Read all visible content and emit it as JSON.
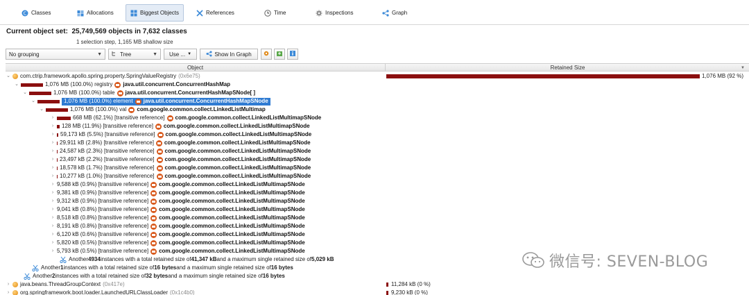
{
  "tabs": [
    {
      "label": "Classes",
      "icon": "classes-icon",
      "active": false
    },
    {
      "label": "Allocations",
      "icon": "allocations-icon",
      "active": false
    },
    {
      "label": "Biggest Objects",
      "icon": "biggest-objects-icon",
      "active": true
    },
    {
      "label": "References",
      "icon": "references-icon",
      "active": false
    },
    {
      "label": "Time",
      "icon": "clock-icon",
      "active": false
    },
    {
      "label": "Inspections",
      "icon": "gear-icon",
      "active": false
    },
    {
      "label": "Graph",
      "icon": "graph-icon",
      "active": false
    }
  ],
  "header": {
    "title_prefix": "Current object set:",
    "title_value": "25,749,569 objects in 7,632 classes",
    "subtitle": "1 selection step, 1,165 MB shallow size"
  },
  "toolbar": {
    "grouping": "No grouping",
    "view": "Tree",
    "use": "Use ...",
    "show_graph": "Show In Graph"
  },
  "columns": {
    "object": "Object",
    "retained": "Retained Size"
  },
  "rows": [
    {
      "kind": "root",
      "name": "com.ctrip.framework.apollo.spring.property.SpringValueRegistry",
      "addr": "(0x6e75)",
      "retained": "1,076 MB (92 %)"
    },
    {
      "kind": "node",
      "pct": "1,076 MB (100.0%) registry",
      "cls": "java.util.concurrent.ConcurrentHashMap"
    },
    {
      "kind": "node",
      "pct": "1,076 MB (100.0%) table",
      "cls": "java.util.concurrent.ConcurrentHashMapSNode[ ]"
    },
    {
      "kind": "node",
      "pct": "1,076 MB (100.0%) element",
      "cls": "java.util.concurrent.ConcurrentHashMapSNode"
    },
    {
      "kind": "node",
      "pct": "1,076 MB (100.0%) val",
      "cls": "com.google.common.collect.LinkedListMultimap"
    },
    {
      "kind": "leaf",
      "pct": "668 MB (62.1%) [transitive reference]",
      "cls": "com.google.common.collect.LinkedListMultimapSNode"
    },
    {
      "kind": "leaf",
      "pct": "128 MB (11.9%) [transitive reference]",
      "cls": "com.google.common.collect.LinkedListMultimapSNode"
    },
    {
      "kind": "leaf",
      "pct": "59,173 kB (5.5%) [transitive reference]",
      "cls": "com.google.common.collect.LinkedListMultimapSNode"
    },
    {
      "kind": "leaf",
      "pct": "29,911 kB (2.8%) [transitive reference]",
      "cls": "com.google.common.collect.LinkedListMultimapSNode"
    },
    {
      "kind": "leaf",
      "pct": "24,587 kB (2.3%) [transitive reference]",
      "cls": "com.google.common.collect.LinkedListMultimapSNode"
    },
    {
      "kind": "leaf",
      "pct": "23,497 kB (2.2%) [transitive reference]",
      "cls": "com.google.common.collect.LinkedListMultimapSNode"
    },
    {
      "kind": "leaf",
      "pct": "18,578 kB (1.7%) [transitive reference]",
      "cls": "com.google.common.collect.LinkedListMultimapSNode"
    },
    {
      "kind": "leaf",
      "pct": "10,277 kB (1.0%) [transitive reference]",
      "cls": "com.google.common.collect.LinkedListMultimapSNode"
    },
    {
      "kind": "leaf",
      "pct": "9,588 kB (0.9%) [transitive reference]",
      "cls": "com.google.common.collect.LinkedListMultimapSNode"
    },
    {
      "kind": "leaf",
      "pct": "9,381 kB (0.9%) [transitive reference]",
      "cls": "com.google.common.collect.LinkedListMultimapSNode"
    },
    {
      "kind": "leaf",
      "pct": "9,312 kB (0.9%) [transitive reference]",
      "cls": "com.google.common.collect.LinkedListMultimapSNode"
    },
    {
      "kind": "leaf",
      "pct": "9,041 kB (0.8%) [transitive reference]",
      "cls": "com.google.common.collect.LinkedListMultimapSNode"
    },
    {
      "kind": "leaf",
      "pct": "8,518 kB (0.8%) [transitive reference]",
      "cls": "com.google.common.collect.LinkedListMultimapSNode"
    },
    {
      "kind": "leaf",
      "pct": "8,191 kB (0.8%) [transitive reference]",
      "cls": "com.google.common.collect.LinkedListMultimapSNode"
    },
    {
      "kind": "leaf",
      "pct": "6,120 kB (0.6%) [transitive reference]",
      "cls": "com.google.common.collect.LinkedListMultimapSNode"
    },
    {
      "kind": "leaf",
      "pct": "5,820 kB (0.5%) [transitive reference]",
      "cls": "com.google.common.collect.LinkedListMultimapSNode"
    },
    {
      "kind": "leaf",
      "pct": "5,793 kB (0.5%) [transitive reference]",
      "cls": "com.google.common.collect.LinkedListMultimapSNode"
    }
  ],
  "summaries": [
    {
      "a": "Another ",
      "n": "4934",
      "b": " instances with a total retained size of ",
      "s": "41,347 kB",
      "c": " and a maximum single retained size of ",
      "m": "5,029 kB"
    },
    {
      "a": "Another ",
      "n": "1",
      "b": " instances with a total retained size of ",
      "s": "16 bytes",
      "c": " and a maximum single retained size of ",
      "m": "16 bytes"
    },
    {
      "a": "Another ",
      "n": "2",
      "b": " instances with a total retained size of ",
      "s": "32 bytes",
      "c": " and a maximum single retained size of ",
      "m": "16 bytes"
    }
  ],
  "bottom_rows": [
    {
      "name": "java.beans.ThreadGroupContext",
      "addr": "(0x417e)",
      "retained": "11,284 kB (0 %)"
    },
    {
      "name": "org.springframework.boot.loader.LaunchedURLClassLoader",
      "addr": "(0x1c4b0)",
      "retained": "9,230 kB (0 %)"
    }
  ],
  "watermark": "微信号: SEVEN-BLOG",
  "colors": {
    "bar": "#8b0f0f",
    "selection": "#2f7bd2",
    "ref_arrow": "#d95b1e",
    "active_tab": "#e4ecf6"
  }
}
